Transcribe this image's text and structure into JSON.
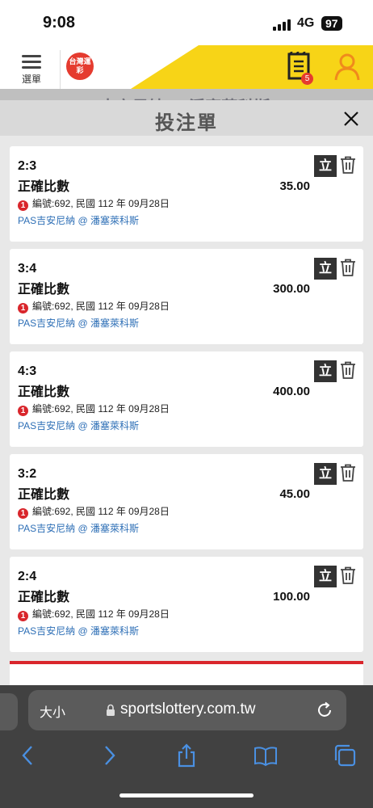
{
  "status_bar": {
    "time": "9:08",
    "network": "4G",
    "battery": "97"
  },
  "header": {
    "menu_label": "選單",
    "logo_text": "台灣運彩",
    "betslip_badge": "5"
  },
  "background_text": "PAS吉安尼納 @ 潘塞萊科斯",
  "betslip": {
    "title": "投注單",
    "single_label": "立",
    "bets": [
      {
        "score": "2:3",
        "type": "正確比數",
        "odds": "35.00",
        "alert": "1",
        "meta": "編號:692, 民國 112 年 09月28日",
        "match": "PAS吉安尼納 @ 潘塞萊科斯"
      },
      {
        "score": "3:4",
        "type": "正確比數",
        "odds": "300.00",
        "alert": "1",
        "meta": "編號:692, 民國 112 年 09月28日",
        "match": "PAS吉安尼納 @ 潘塞萊科斯"
      },
      {
        "score": "4:3",
        "type": "正確比數",
        "odds": "400.00",
        "alert": "1",
        "meta": "編號:692, 民國 112 年 09月28日",
        "match": "PAS吉安尼納 @ 潘塞萊科斯"
      },
      {
        "score": "3:2",
        "type": "正確比數",
        "odds": "45.00",
        "alert": "1",
        "meta": "編號:692, 民國 112 年 09月28日",
        "match": "PAS吉安尼納 @ 潘塞萊科斯"
      },
      {
        "score": "2:4",
        "type": "正確比數",
        "odds": "100.00",
        "alert": "1",
        "meta": "編號:692, 民國 112 年 09月28日",
        "match": "PAS吉安尼納 @ 潘塞萊科斯"
      }
    ]
  },
  "browser": {
    "text_size_label": "大小",
    "url": "sportslottery.com.tw"
  },
  "colors": {
    "accent_yellow": "#f7d417",
    "accent_orange": "#f08a1c",
    "alert_red": "#d9262c",
    "link_blue": "#2e6fb6",
    "browser_blue": "#4a90e2"
  }
}
